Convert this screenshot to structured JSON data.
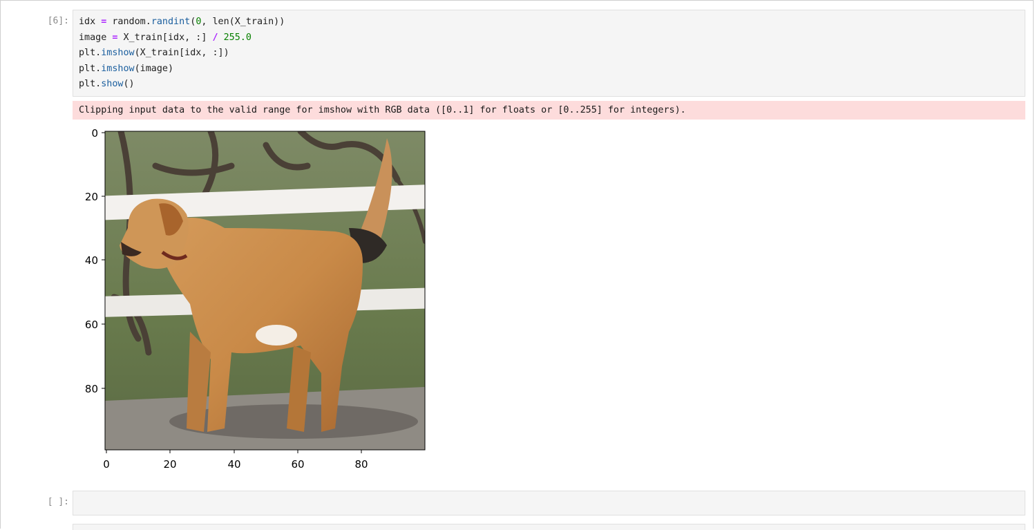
{
  "cells": [
    {
      "prompt": "[6]:",
      "code_lines": [
        "idx = random.randint(0, len(X_train))",
        "image = X_train[idx, :] / 255.0",
        "plt.imshow(X_train[idx, :])",
        "plt.imshow(image)",
        "plt.show()"
      ],
      "stderr": "Clipping input data to the valid range for imshow with RGB data ([0..1] for floats or [0..255] for integers)."
    },
    {
      "prompt": "[ ]:",
      "code_lines": []
    }
  ],
  "plot": {
    "image_subject": "dog",
    "x_ticks": [
      "0",
      "20",
      "40",
      "60",
      "80"
    ],
    "y_ticks": [
      "0",
      "20",
      "40",
      "60",
      "80"
    ],
    "colors": {
      "fur": "#c98a48",
      "grass": "#6f8052",
      "fence": "#f3f1ee",
      "ground": "#8f8b84",
      "branches": "#4a4036"
    }
  }
}
